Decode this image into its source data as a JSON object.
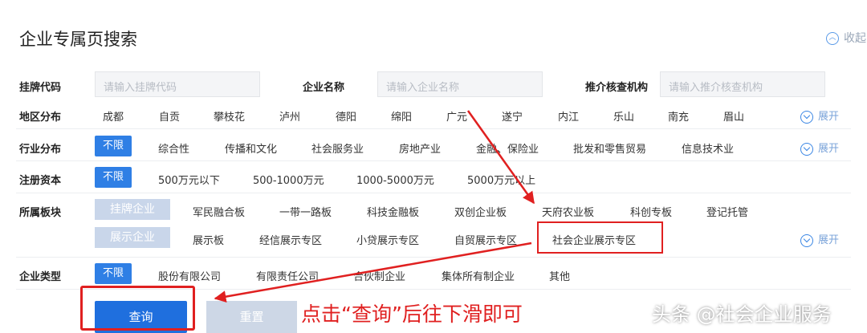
{
  "header": {
    "title": "企业专属页搜索",
    "collapse_label": "收起"
  },
  "search": {
    "code_label": "挂牌代码",
    "code_placeholder": "请输入挂牌代码",
    "name_label": "企业名称",
    "name_placeholder": "请输入企业名称",
    "agency_label": "推介核查机构",
    "agency_placeholder": "请输入推介核查机构"
  },
  "region": {
    "label": "地区分布",
    "options": [
      "成都",
      "自贡",
      "攀枝花",
      "泸州",
      "德阳",
      "绵阳",
      "广元",
      "遂宁",
      "内江",
      "乐山",
      "南充",
      "眉山"
    ],
    "expand": "展开"
  },
  "industry": {
    "label": "行业分布",
    "all": "不限",
    "options": [
      "综合性",
      "传播和文化",
      "社会服务业",
      "房地产业",
      "金融、保险业",
      "批发和零售贸易",
      "信息技术业"
    ],
    "expand": "展开"
  },
  "capital": {
    "label": "注册资本",
    "all": "不限",
    "options": [
      "500万元以下",
      "500-1000万元",
      "1000-5000万元",
      "5000万元以上"
    ]
  },
  "board": {
    "label": "所属板块",
    "listed_chip": "挂牌企业",
    "listed_options": [
      "军民融合板",
      "一带一路板",
      "科技金融板",
      "双创企业板",
      "天府农业板",
      "科创专板",
      "登记托管"
    ],
    "show_chip": "展示企业",
    "show_options": [
      "展示板",
      "经信展示专区",
      "小贷展示专区",
      "自贸展示专区",
      "社会企业展示专区"
    ],
    "expand": "展开"
  },
  "type": {
    "label": "企业类型",
    "all": "不限",
    "options": [
      "股份有限公司",
      "有限责任公司",
      "合伙制企业",
      "集体所有制企业",
      "其他"
    ]
  },
  "actions": {
    "query": "查询",
    "reset": "重置"
  },
  "annotation": "点击“查询”后往下滑即可",
  "watermark": "头条 @社会企业服务",
  "colors": {
    "primary": "#2f7fe5",
    "annotation": "#e02020"
  }
}
